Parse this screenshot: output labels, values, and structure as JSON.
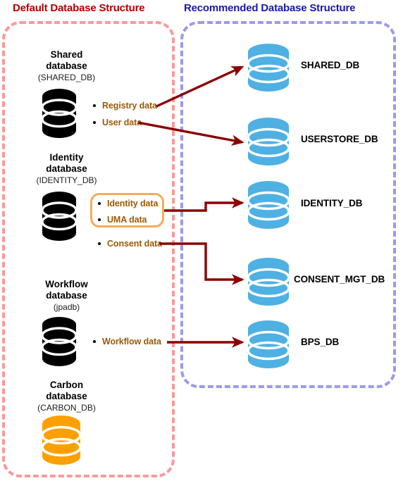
{
  "panels": {
    "default": {
      "title": "Default Database Structure",
      "title_color": "#b00000",
      "border_color": "#f99a99"
    },
    "recommended": {
      "title": "Recommended Database Structure",
      "title_color": "#1a1aa8",
      "border_color": "#9a9aee"
    }
  },
  "colors": {
    "black_db": "#000000",
    "orange_db": "#fba000",
    "blue_db": "#4fb0e3",
    "arrow": "#8b0000",
    "data_label": "#9c5a05",
    "highlight_border": "#f7ab58"
  },
  "source_databases": [
    {
      "name": "Shared",
      "name_line2": "database",
      "alias": "(SHARED_DB)",
      "cylinder_color": "black",
      "data_items": [
        "Registry data",
        "User data"
      ]
    },
    {
      "name": "Identity",
      "name_line2": "database",
      "alias": "(IDENTITY_DB)",
      "cylinder_color": "black",
      "data_items": [
        "Identity data",
        "UMA data",
        "Consent data"
      ]
    },
    {
      "name": "Workflow",
      "name_line2": "database",
      "alias": "(jpadb)",
      "cylinder_color": "black",
      "data_items": [
        "Workflow data"
      ]
    },
    {
      "name": "Carbon",
      "name_line2": "database",
      "alias": "(CARBON_DB)",
      "cylinder_color": "orange",
      "data_items": []
    }
  ],
  "target_databases": [
    {
      "label": "SHARED_DB",
      "cylinder_color": "blue"
    },
    {
      "label": "USERSTORE_DB",
      "cylinder_color": "blue"
    },
    {
      "label": "IDENTITY_DB",
      "cylinder_color": "blue"
    },
    {
      "label": "CONSENT_MGT_DB",
      "cylinder_color": "blue"
    },
    {
      "label": "BPS_DB",
      "cylinder_color": "blue"
    }
  ],
  "mappings": [
    {
      "from": "Registry data",
      "to": "SHARED_DB"
    },
    {
      "from": "User data",
      "to": "USERSTORE_DB"
    },
    {
      "from": "Identity data / UMA data",
      "to": "IDENTITY_DB"
    },
    {
      "from": "Consent data",
      "to": "CONSENT_MGT_DB"
    },
    {
      "from": "Workflow data",
      "to": "BPS_DB"
    }
  ]
}
